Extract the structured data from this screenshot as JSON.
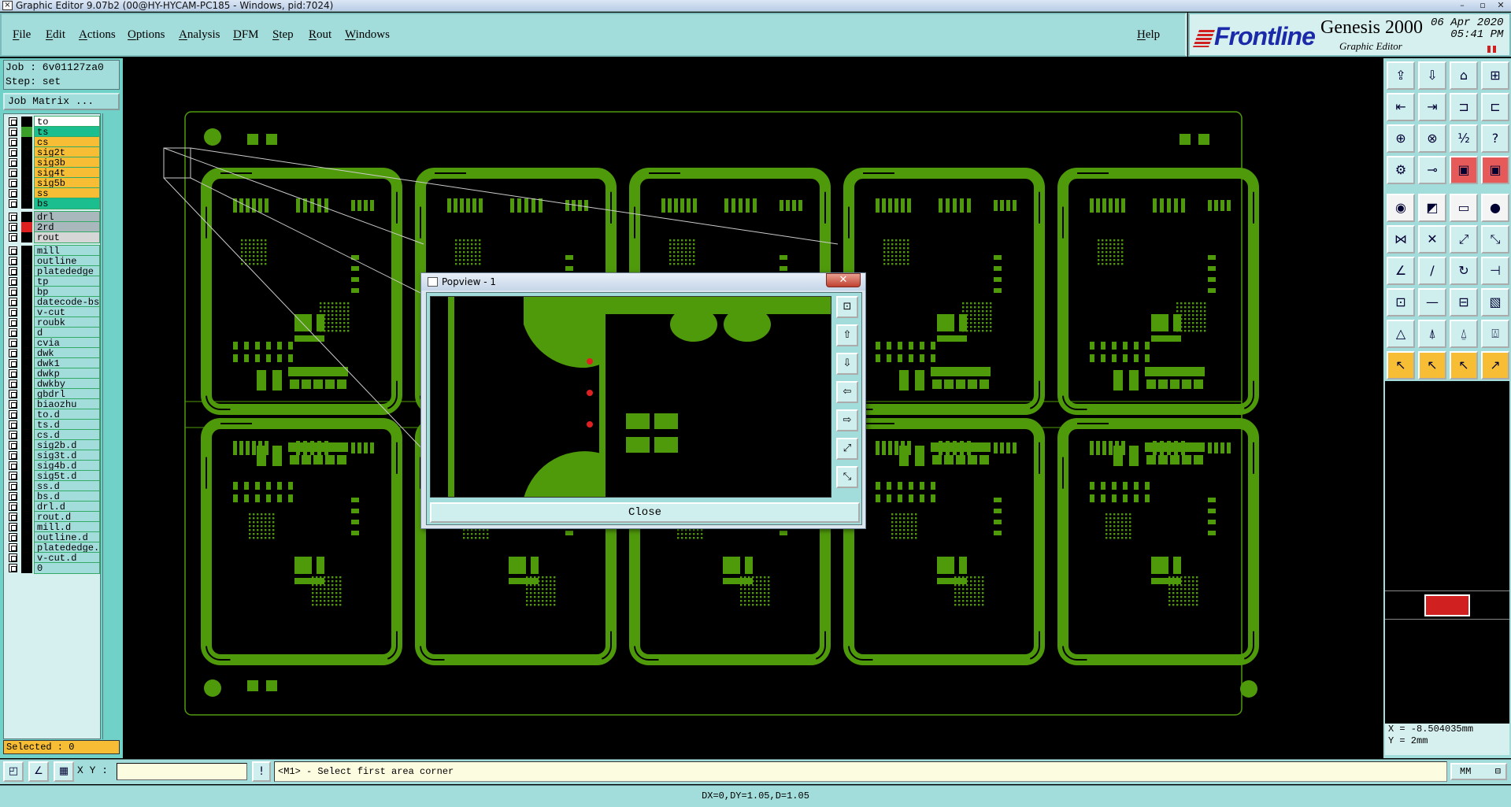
{
  "window": {
    "title": "Graphic Editor 9.07b2 (00@HY-HYCAM-PC185 - Windows, pid:7024)"
  },
  "menu": {
    "items": [
      "File",
      "Edit",
      "Actions",
      "Options",
      "Analysis",
      "DFM",
      "Step",
      "Rout",
      "Windows"
    ],
    "help": "Help"
  },
  "logo": {
    "brand": "Frontline",
    "product": "Genesis 2000",
    "subtitle": "Graphic Editor",
    "date": "06 Apr 2020",
    "time": "05:41 PM"
  },
  "job": {
    "job_line": "Job : 6v01127za0",
    "step_line": "Step: set",
    "matrix_button": "Job Matrix ..."
  },
  "layers": [
    {
      "name": "to",
      "color": "#000000",
      "bg": "#ffffff"
    },
    {
      "name": "ts",
      "color": "#3aa02a",
      "bg": "#1bbf8f"
    },
    {
      "name": "cs",
      "color": "#000000",
      "bg": "#f7be35"
    },
    {
      "name": "sig2t",
      "color": "#000000",
      "bg": "#f7be35"
    },
    {
      "name": "sig3b",
      "color": "#000000",
      "bg": "#f7be35"
    },
    {
      "name": "sig4t",
      "color": "#000000",
      "bg": "#f7be35"
    },
    {
      "name": "sig5b",
      "color": "#000000",
      "bg": "#f7be35"
    },
    {
      "name": "ss",
      "color": "#000000",
      "bg": "#f7be35"
    },
    {
      "name": "bs",
      "color": "#000000",
      "bg": "#1bbf8f"
    },
    {
      "name": "drl",
      "color": "#000000",
      "bg": "#a8b8bc"
    },
    {
      "name": "2rd",
      "color": "#e02020",
      "bg": "#a8b8bc"
    },
    {
      "name": "rout",
      "color": "#000000",
      "bg": "#d6d6d6"
    },
    {
      "name": "mill",
      "color": "#000000",
      "bg": "#a2dcdb"
    },
    {
      "name": "outline",
      "color": "#000000",
      "bg": "#a2dcdb"
    },
    {
      "name": "platededge",
      "color": "#000000",
      "bg": "#a2dcdb"
    },
    {
      "name": "tp",
      "color": "#000000",
      "bg": "#a2dcdb"
    },
    {
      "name": "bp",
      "color": "#000000",
      "bg": "#a2dcdb"
    },
    {
      "name": "datecode-bs",
      "color": "#000000",
      "bg": "#a2dcdb"
    },
    {
      "name": "v-cut",
      "color": "#000000",
      "bg": "#a2dcdb"
    },
    {
      "name": "roubk",
      "color": "#000000",
      "bg": "#a2dcdb"
    },
    {
      "name": "d",
      "color": "#000000",
      "bg": "#a2dcdb"
    },
    {
      "name": "cvia",
      "color": "#000000",
      "bg": "#a2dcdb"
    },
    {
      "name": "dwk",
      "color": "#000000",
      "bg": "#a2dcdb"
    },
    {
      "name": "dwk1",
      "color": "#000000",
      "bg": "#a2dcdb"
    },
    {
      "name": "dwkp",
      "color": "#000000",
      "bg": "#a2dcdb"
    },
    {
      "name": "dwkby",
      "color": "#000000",
      "bg": "#a2dcdb"
    },
    {
      "name": "gbdrl",
      "color": "#000000",
      "bg": "#a2dcdb"
    },
    {
      "name": "biaozhu",
      "color": "#000000",
      "bg": "#a2dcdb"
    },
    {
      "name": "to.d",
      "color": "#000000",
      "bg": "#a2dcdb"
    },
    {
      "name": "ts.d",
      "color": "#000000",
      "bg": "#a2dcdb"
    },
    {
      "name": "cs.d",
      "color": "#000000",
      "bg": "#a2dcdb"
    },
    {
      "name": "sig2b.d",
      "color": "#000000",
      "bg": "#a2dcdb"
    },
    {
      "name": "sig3t.d",
      "color": "#000000",
      "bg": "#a2dcdb"
    },
    {
      "name": "sig4b.d",
      "color": "#000000",
      "bg": "#a2dcdb"
    },
    {
      "name": "sig5t.d",
      "color": "#000000",
      "bg": "#a2dcdb"
    },
    {
      "name": "ss.d",
      "color": "#000000",
      "bg": "#a2dcdb"
    },
    {
      "name": "bs.d",
      "color": "#000000",
      "bg": "#a2dcdb"
    },
    {
      "name": "drl.d",
      "color": "#000000",
      "bg": "#a2dcdb"
    },
    {
      "name": "rout.d",
      "color": "#000000",
      "bg": "#a2dcdb"
    },
    {
      "name": "mill.d",
      "color": "#000000",
      "bg": "#a2dcdb"
    },
    {
      "name": "outline.d",
      "color": "#000000",
      "bg": "#a2dcdb"
    },
    {
      "name": "platededge.d",
      "color": "#000000",
      "bg": "#a2dcdb"
    },
    {
      "name": "v-cut.d",
      "color": "#000000",
      "bg": "#a2dcdb"
    },
    {
      "name": "0",
      "color": "#000000",
      "bg": "#a2dcdb"
    }
  ],
  "selected": "Selected : 0",
  "popup": {
    "title": "Popview - 1",
    "close_label": "Close"
  },
  "coords": {
    "x_line": "X = -8.504035mm",
    "y_line": "Y = 2mm"
  },
  "command": {
    "xy_label": "X Y :",
    "prompt": "<M1> - Select first area corner",
    "unit": "MM"
  },
  "status": "DX=0,DY=1.05,D=1.05",
  "colors": {
    "copper": "#4f9a0a",
    "panel_bg": "#a2dcdb",
    "accent_orange": "#f7be35"
  }
}
